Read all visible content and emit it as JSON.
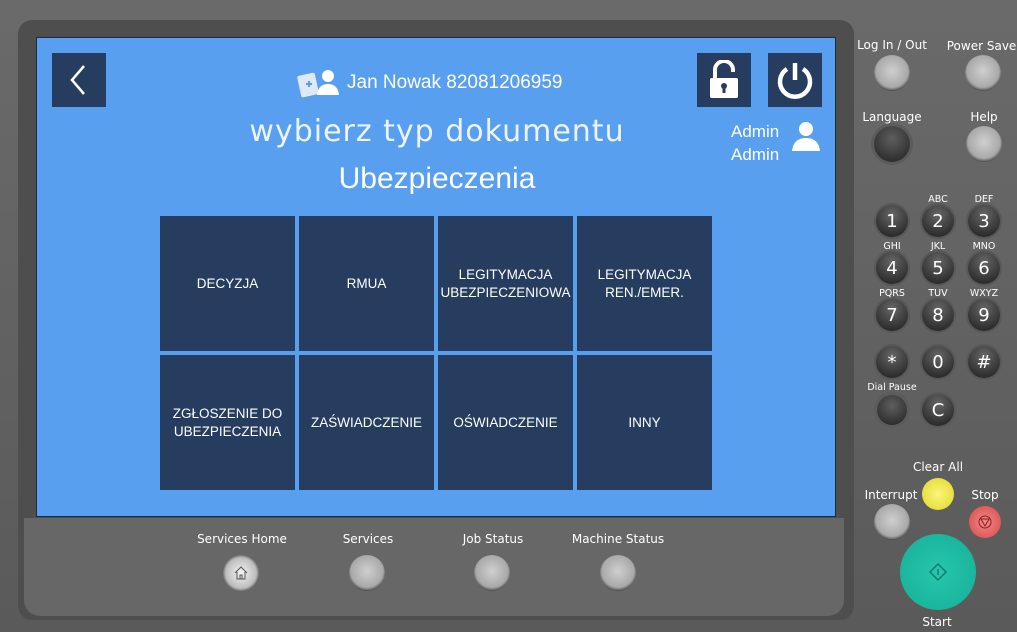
{
  "screen": {
    "patient": "Jan Nowak 82081206959",
    "title": "wybierz typ dokumentu",
    "subtitle": "Ubezpieczenia",
    "user": {
      "first": "Admin",
      "last": "Admin"
    },
    "tiles": [
      "DECYZJA",
      "RMUA",
      "LEGITYMACJA\nUBEZPIECZENIOWA",
      "LEGITYMACJA\nREN./EMER.",
      "ZGŁOSZENIE DO\nUBEZPIECZENIA",
      "ZAŚWIADCZENIE",
      "OŚWIADCZENIE",
      "INNY"
    ],
    "colors": {
      "background": "#589ff0",
      "tile": "#263d5f"
    }
  },
  "hardware": {
    "login": "Log In / Out",
    "power_saver": "Power Saver",
    "language": "Language",
    "help": "Help",
    "keys": [
      {
        "d": "1",
        "l": ""
      },
      {
        "d": "2",
        "l": "ABC"
      },
      {
        "d": "3",
        "l": "DEF"
      },
      {
        "d": "4",
        "l": "GHI"
      },
      {
        "d": "5",
        "l": "JKL"
      },
      {
        "d": "6",
        "l": "MNO"
      },
      {
        "d": "7",
        "l": "PQRS"
      },
      {
        "d": "8",
        "l": "TUV"
      },
      {
        "d": "9",
        "l": "WXYZ"
      },
      {
        "d": "*",
        "l": ""
      },
      {
        "d": "0",
        "l": ""
      },
      {
        "d": "#",
        "l": ""
      }
    ],
    "dial_pause": "Dial Pause",
    "clear": "C",
    "clear_all": "Clear All",
    "interrupt": "Interrupt",
    "stop": "Stop",
    "start": "Start",
    "services_home": "Services Home",
    "services": "Services",
    "job_status": "Job Status",
    "machine_status": "Machine Status"
  }
}
